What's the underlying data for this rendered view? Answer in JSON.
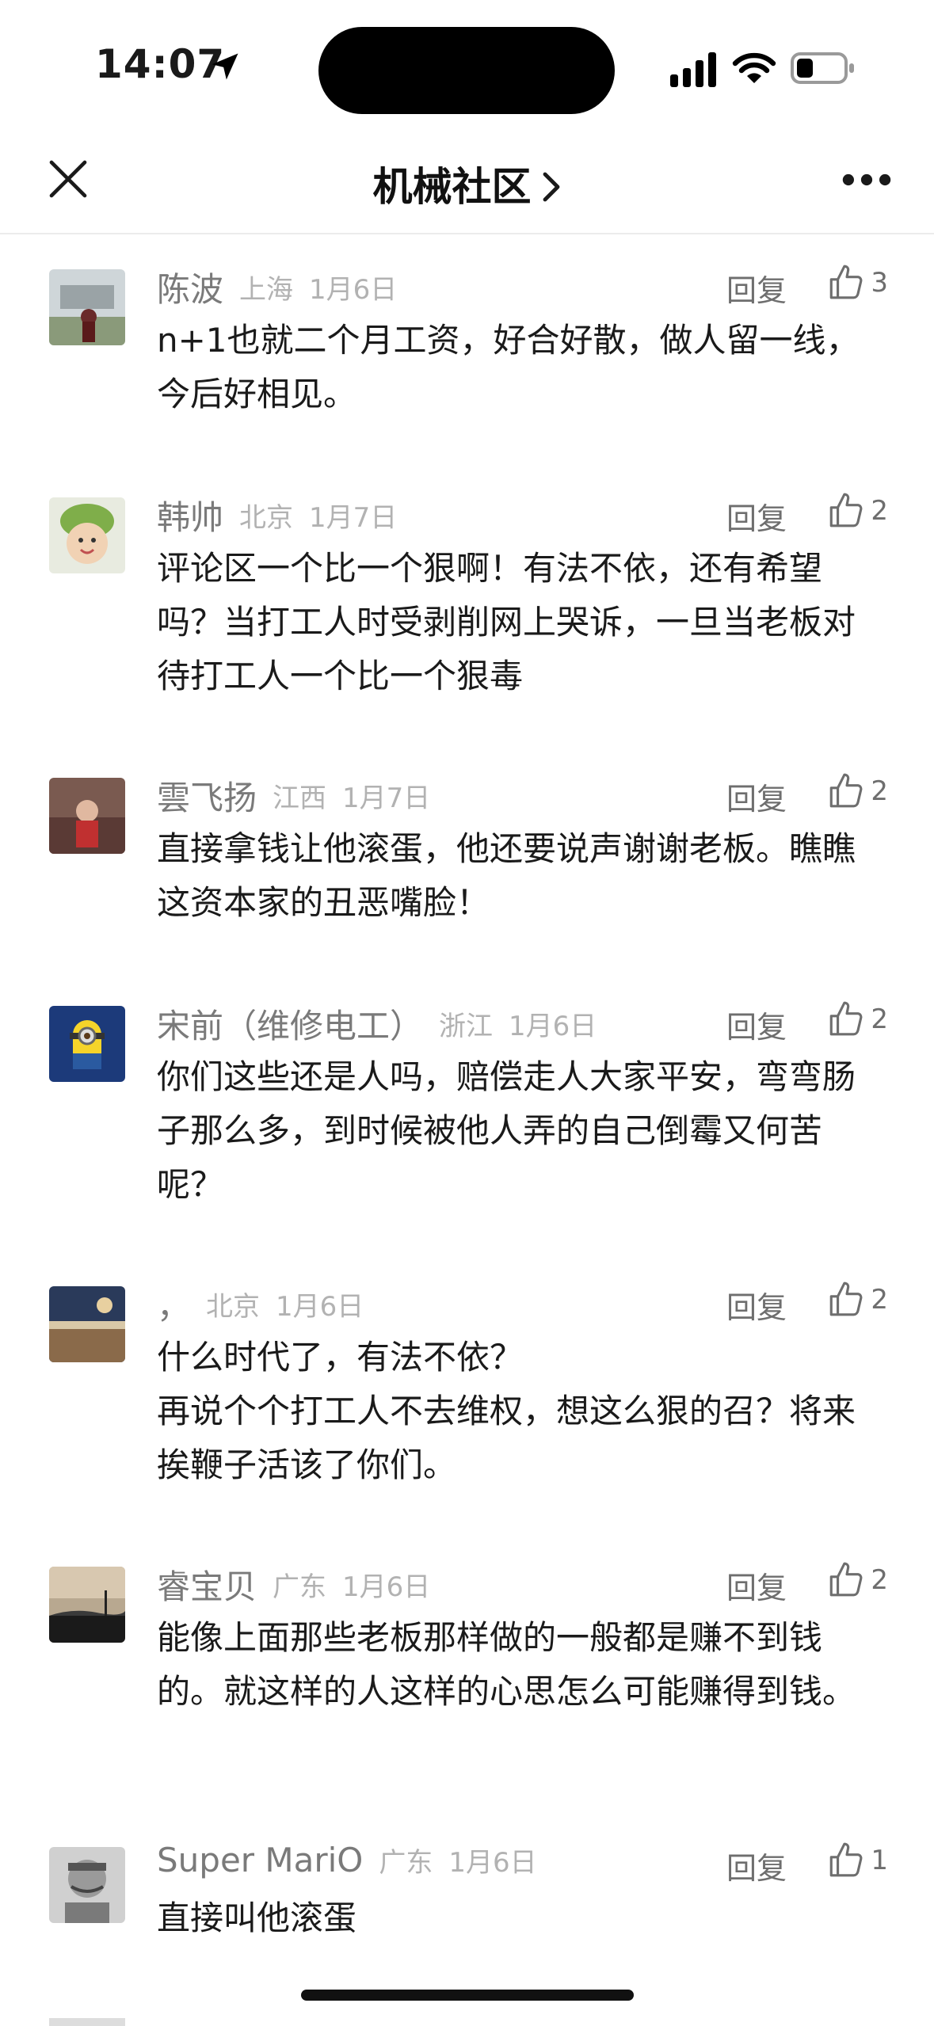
{
  "status_bar": {
    "time": "14:07"
  },
  "nav": {
    "title": "机械社区"
  },
  "comments": [
    {
      "user": "陈波",
      "location": "上海",
      "date": "1月6日",
      "reply_label": "回复",
      "likes": "3",
      "text": "n+1也就二个月工资，好合好散，做人留一线，今后好相见。"
    },
    {
      "user": "韩帅",
      "location": "北京",
      "date": "1月7日",
      "reply_label": "回复",
      "likes": "2",
      "text": "评论区一个比一个狠啊！有法不依，还有希望吗？当打工人时受剥削网上哭诉，一旦当老板对待打工人一个比一个狠毒"
    },
    {
      "user": "雲飞扬",
      "location": "江西",
      "date": "1月7日",
      "reply_label": "回复",
      "likes": "2",
      "text": "直接拿钱让他滚蛋，他还要说声谢谢老板。瞧瞧这资本家的丑恶嘴脸！"
    },
    {
      "user": "宋前（维修电工）",
      "location": "浙江",
      "date": "1月6日",
      "reply_label": "回复",
      "likes": "2",
      "text": "你们这些还是人吗，赔偿走人大家平安，弯弯肠子那么多，到时候被他人弄的自己倒霉又何苦呢？"
    },
    {
      "user": "，",
      "location": "北京",
      "date": "1月6日",
      "reply_label": "回复",
      "likes": "2",
      "text": "什么时代了，有法不依？\n再说个个打工人不去维权，想这么狠的召？将来挨鞭子活该了你们。"
    },
    {
      "user": "睿宝贝",
      "location": "广东",
      "date": "1月6日",
      "reply_label": "回复",
      "likes": "2",
      "text": "能像上面那些老板那样做的一般都是赚不到钱的。就这样的人这样的心思怎么可能赚得到钱。"
    },
    {
      "user": "Super MariO",
      "location": "广东",
      "date": "1月6日",
      "reply_label": "回复",
      "likes": "1",
      "text": "直接叫他滚蛋"
    }
  ]
}
